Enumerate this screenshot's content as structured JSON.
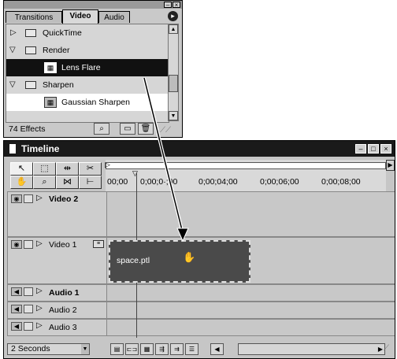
{
  "effects": {
    "tabs": [
      "Transitions",
      "Video",
      "Audio"
    ],
    "items": [
      {
        "label": "QuickTime",
        "kind": "folder",
        "expanded": false
      },
      {
        "label": "Render",
        "kind": "folder",
        "expanded": true
      },
      {
        "label": "Lens Flare",
        "kind": "effect",
        "selected": true
      },
      {
        "label": "Sharpen",
        "kind": "folder",
        "expanded": true
      },
      {
        "label": "Gaussian Sharpen",
        "kind": "effect",
        "selected": false
      }
    ],
    "count": "74 Effects"
  },
  "timeline": {
    "title": "Timeline",
    "ruler_labels": [
      "00;00",
      "0;00;0·;00",
      "0;00;04;00",
      "0;00;06;00",
      "0;00;08;00"
    ],
    "tracks": [
      {
        "name": "Video 2",
        "bold": true,
        "kind": "video"
      },
      {
        "name": "Video 1",
        "bold": false,
        "kind": "video"
      },
      {
        "name": "Audio 1",
        "bold": true,
        "kind": "audio"
      },
      {
        "name": "Audio 2",
        "bold": false,
        "kind": "audio"
      },
      {
        "name": "Audio 3",
        "bold": false,
        "kind": "audio"
      }
    ],
    "clip_label": "space.ptl",
    "zoom": "2 Seconds"
  },
  "icons": {
    "folder": "folder-icon",
    "effect": "effect-icon",
    "binoculars": "binoculars-icon",
    "new_bin": "new-folder-icon",
    "trash": "trash-icon",
    "eye": "eye-icon",
    "speaker": "speaker-icon",
    "hand": "hand-cursor-icon"
  }
}
